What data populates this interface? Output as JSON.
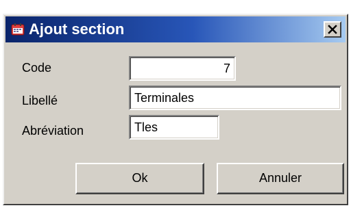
{
  "window": {
    "title": "Ajout section",
    "icon": "app-window-icon",
    "close_icon": "close-icon"
  },
  "form": {
    "code_label": "Code",
    "code_value": "7",
    "libelle_label": "Libellé",
    "libelle_value": "Terminales",
    "abreviation_label": "Abréviation",
    "abreviation_value": "Tles"
  },
  "buttons": {
    "ok_label": "Ok",
    "cancel_label": "Annuler"
  },
  "colors": {
    "titlebar_start": "#0a246a",
    "titlebar_end": "#a6caf0",
    "dialog_background": "#d4d0c8"
  }
}
